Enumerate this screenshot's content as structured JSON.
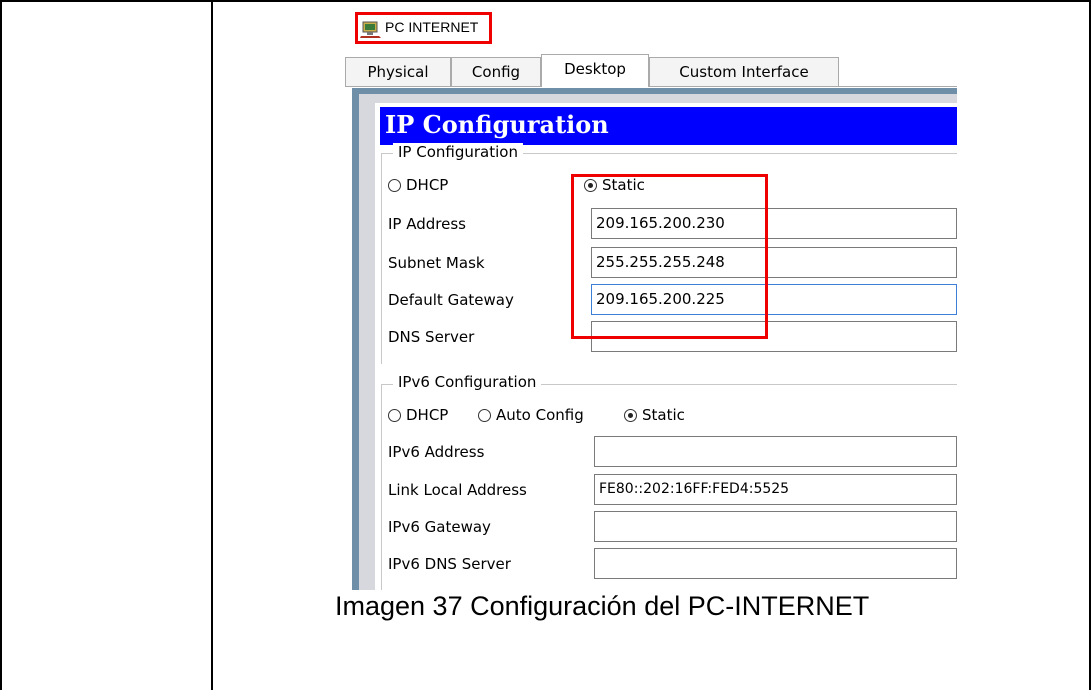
{
  "window": {
    "title": "PC INTERNET",
    "icon": "pc-icon"
  },
  "tabs": [
    {
      "label": "Physical",
      "active": false
    },
    {
      "label": "Config",
      "active": false
    },
    {
      "label": "Desktop",
      "active": true
    },
    {
      "label": "Custom Interface",
      "active": false
    }
  ],
  "heading": "IP Configuration",
  "ipv4": {
    "group_label": "IP Configuration",
    "dhcp_label": "DHCP",
    "static_label": "Static",
    "mode": "Static",
    "ip_label": "IP Address",
    "ip_value": "209.165.200.230",
    "mask_label": "Subnet Mask",
    "mask_value": "255.255.255.248",
    "gateway_label": "Default Gateway",
    "gateway_value": "209.165.200.225",
    "dns_label": "DNS Server",
    "dns_value": ""
  },
  "ipv6": {
    "group_label": "IPv6 Configuration",
    "dhcp_label": "DHCP",
    "auto_label": "Auto Config",
    "static_label": "Static",
    "mode": "Static",
    "address_label": "IPv6 Address",
    "address_value": "",
    "link_local_label": "Link Local Address",
    "link_local_value": "FE80::202:16FF:FED4:5525",
    "gateway_label": "IPv6 Gateway",
    "gateway_value": "",
    "dns_label": "IPv6 DNS Server",
    "dns_value": ""
  },
  "caption": "Imagen 37 Configuración del PC-INTERNET",
  "colors": {
    "heading_bg": "#0000ff",
    "highlight": "#ee0000",
    "frame": "#6f8fa9"
  }
}
